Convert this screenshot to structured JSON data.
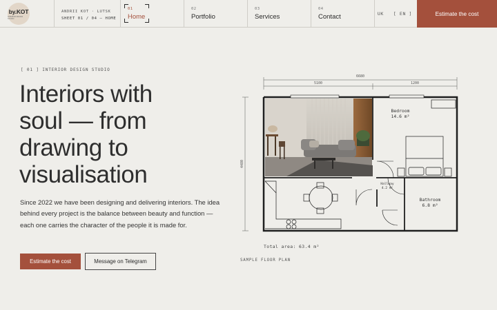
{
  "header": {
    "logo": {
      "text": "by.KOT",
      "sub": "INTERIOR DESIGN STUDIO"
    },
    "owner_line": "ANDRII KOT · LUTSK",
    "sheet_line": "SHEET 01 / 04 — HOME",
    "nav": [
      {
        "num": "01",
        "label": "Home",
        "active": true
      },
      {
        "num": "02",
        "label": "Portfolio",
        "active": false
      },
      {
        "num": "03",
        "label": "Services",
        "active": false
      },
      {
        "num": "04",
        "label": "Contact",
        "active": false
      }
    ],
    "lang_uk": "UK",
    "lang_en": "[ EN ]",
    "cta": "Estimate the cost"
  },
  "hero": {
    "eyebrow": "[ 01 ] INTERIOR DESIGN STUDIO",
    "headline_lines": [
      "Interiors with",
      "soul — from",
      "drawing to",
      "visualisation"
    ],
    "intro": "Since 2022 we have been designing and delivering interiors. The idea behind every project is the balance between beauty and function — each one carries the character of the people it is made for.",
    "primary_button": "Estimate the cost",
    "secondary_button": "Message on Telegram"
  },
  "plan": {
    "dim_total": "6680",
    "dim_left": "5100",
    "dim_right": "1200",
    "dim_height": "4480",
    "rooms": {
      "bedroom_name": "Bedroom",
      "bedroom_area": "14.6 m²",
      "hallway_name": "Hallway",
      "hallway_area": "4.2 m²",
      "bathroom_name": "Bathroom",
      "bathroom_area": "6.8 m²"
    },
    "total_area": "Total area: 63.4 m²",
    "caption": "SAMPLE FLOOR PLAN"
  },
  "colors": {
    "accent": "#a4503c",
    "background": "#efeeea",
    "ink": "#2a2a2a"
  }
}
